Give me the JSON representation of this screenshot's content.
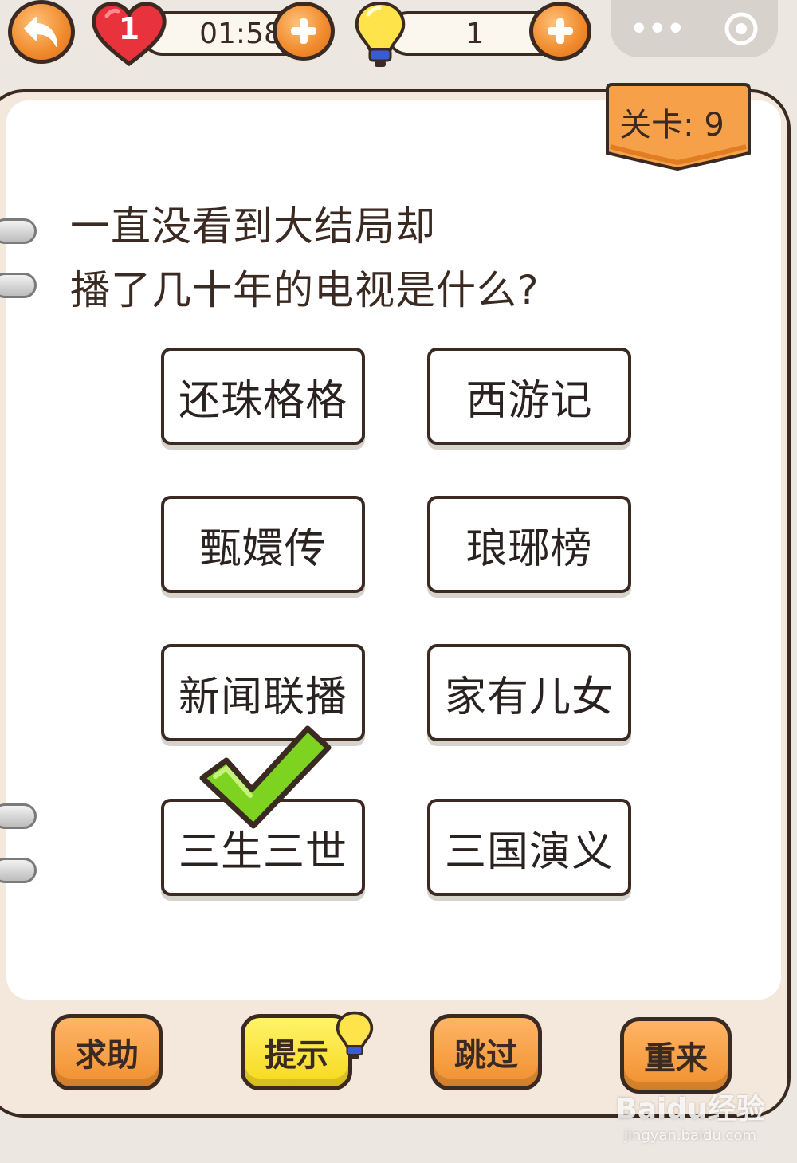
{
  "top_bar": {
    "lives": "1",
    "timer": "01:58",
    "hints": "1",
    "menu_glyph": "•••"
  },
  "level": {
    "label": "关卡: 9"
  },
  "question": {
    "line1": "一直没看到大结局却",
    "line2": "播了几十年的电视是什么?"
  },
  "options": [
    {
      "label": "还珠格格"
    },
    {
      "label": "西游记"
    },
    {
      "label": "甄嬛传"
    },
    {
      "label": "琅琊榜"
    },
    {
      "label": "新闻联播"
    },
    {
      "label": "家有儿女"
    },
    {
      "label": "三生三世"
    },
    {
      "label": "三国演义"
    }
  ],
  "bottom_buttons": {
    "help": "求助",
    "hint": "提示",
    "skip": "跳过",
    "restart": "重来"
  },
  "watermark": {
    "main": "Baidu经验",
    "sub": "jingyan.baidu.com"
  },
  "colors": {
    "orange": "#f08a2c",
    "yellow": "#f6d81c",
    "heart_red": "#e8323c",
    "check_green": "#7ed321",
    "outline": "#3a2a22"
  },
  "icons": [
    "back-arrow-icon",
    "heart-icon",
    "plus-icon",
    "lightbulb-icon",
    "more-icon",
    "record-icon",
    "checkmark-icon"
  ]
}
